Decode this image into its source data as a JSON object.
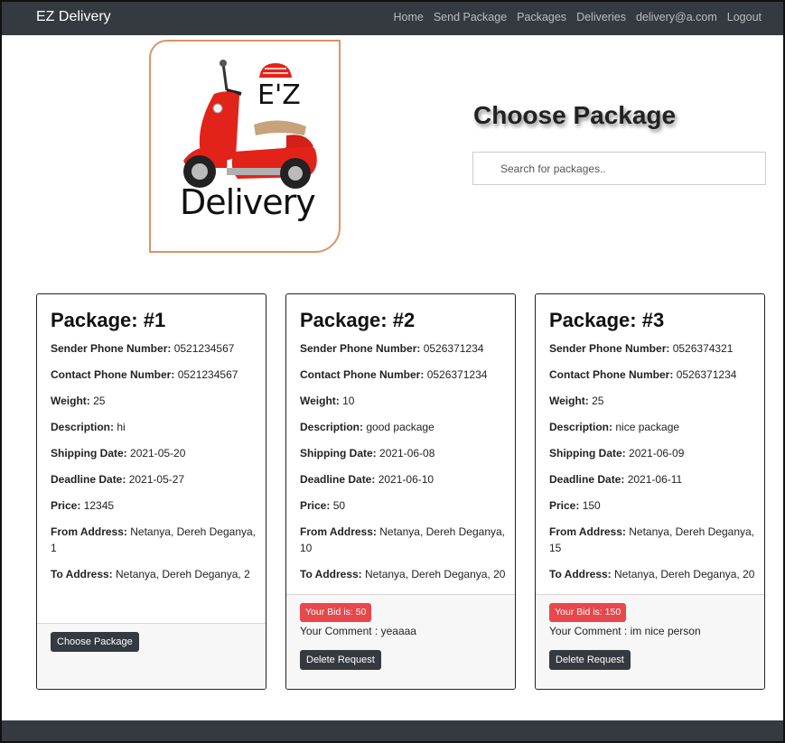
{
  "navbar": {
    "brand": "EZ Delivery",
    "links": [
      "Home",
      "Send Package",
      "Packages",
      "Deliveries",
      "delivery@a.com",
      "Logout"
    ]
  },
  "logo": {
    "top_text": "E'Z",
    "bottom_text": "Delivery",
    "colors": {
      "scooter": "#e2231a",
      "seat": "#c8a27a",
      "helmet": "#e2231a",
      "border": "#d9956a"
    }
  },
  "header": {
    "title": "Choose Package"
  },
  "search": {
    "placeholder": "Search for packages.."
  },
  "field_labels": {
    "sender": "Sender Phone Number:",
    "contact": "Contact Phone Number:",
    "weight": "Weight:",
    "description": "Description:",
    "shipping": "Shipping Date:",
    "deadline": "Deadline Date:",
    "price": "Price:",
    "from": "From Address:",
    "to": "To Address:"
  },
  "packages": [
    {
      "title": "Package: #1",
      "sender": "0521234567",
      "contact": "0521234567",
      "weight": "25",
      "description": "hi",
      "shipping": "2021-05-20",
      "deadline": "2021-05-27",
      "price": "12345",
      "from": "Netanya, Dereh Deganya, 1",
      "to": "Netanya, Dereh Deganya, 2",
      "button": "Choose Package"
    },
    {
      "title": "Package: #2",
      "sender": "0526371234",
      "contact": "0526371234",
      "weight": "10",
      "description": "good package",
      "shipping": "2021-06-08",
      "deadline": "2021-06-10",
      "price": "50",
      "from": "Netanya, Dereh Deganya, 10",
      "to": "Netanya, Dereh Deganya, 20",
      "bid": "Your Bid is: 50",
      "comment": "Your Comment : yeaaaa",
      "button": "Delete Request"
    },
    {
      "title": "Package: #3",
      "sender": "0526374321",
      "contact": "0526371234",
      "weight": "25",
      "description": "nice package",
      "shipping": "2021-06-09",
      "deadline": "2021-06-11",
      "price": "150",
      "from": "Netanya, Dereh Deganya, 15",
      "to": "Netanya, Dereh Deganya, 20",
      "bid": "Your Bid is: 150",
      "comment": "Your Comment : im nice person",
      "button": "Delete Request"
    }
  ],
  "colors": {
    "navbar": "#343a40",
    "badge": "#e8474b",
    "button": "#343a40"
  }
}
